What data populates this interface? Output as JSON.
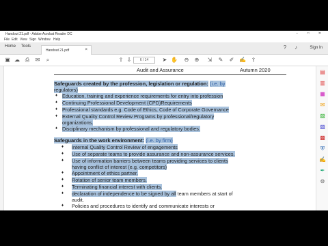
{
  "window": {
    "title": "Handout 21.pdf - Adobe Acrobat Reader DC",
    "controls": [
      "–",
      "□",
      "✕"
    ]
  },
  "menu": [
    "File",
    "Edit",
    "View",
    "Sign",
    "Window",
    "Help"
  ],
  "tabs": {
    "home": "Home",
    "tools": "Tools",
    "document": "Handout 21.pdf",
    "sign_in": "Sign In"
  },
  "toolbar": {
    "page_current": "6",
    "page_total": "/ 14"
  },
  "document": {
    "header_left": "Audit and Assurance",
    "header_right": "Autumn 2020",
    "section1": {
      "title": "Safeguards created by the profession, legislation or regulation:",
      "subtitle": "(i.e. by",
      "subtitle_cont": "regulators)",
      "items": [
        "Education, training and experience requirements for entry into profession",
        "Continuing Professional Development (CPD)Requirements",
        "Professional standards e.g. Code of Ethics, Code of Corporate Governance",
        "External Quality Control Review Programs by professional/regulatory",
        "organizations.",
        "Disciplinary mechanism by professional and regulatory bodies."
      ]
    },
    "section2": {
      "title": "Safeguards in the work environment:",
      "subtitle": "(i.e. by firm)",
      "items": [
        "Internal Quality Control Review of engagements",
        "Use of separate teams to provide assurance and non-assurance services.",
        "Use of information barriers between teams providing services to clients",
        "having conflict of interest (e.g. competitors)",
        "Appointment of ethics partner.",
        "Rotation of senior team members.",
        "Terminating financial interest with clients.",
        "declaration of independence to be signed by all",
        "team members at start of",
        "audit.",
        "Policies and procedures to identify and communicate interests or"
      ]
    }
  },
  "colors": {
    "highlight": "#a9c3de",
    "accent_blue": "#2a5aa0"
  }
}
